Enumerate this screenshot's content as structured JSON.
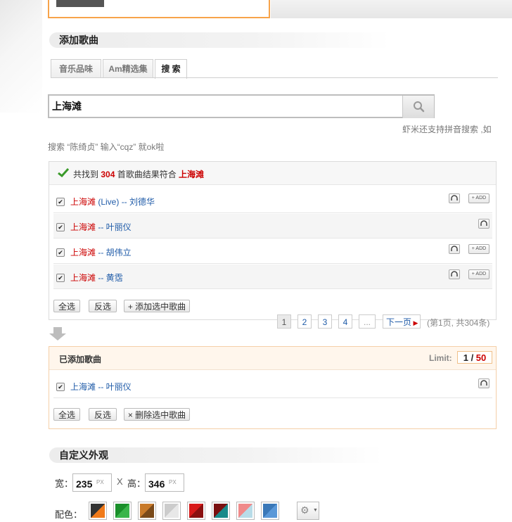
{
  "add_songs": {
    "title": "添加歌曲",
    "tabs": [
      {
        "label": "音乐品味"
      },
      {
        "label": "Am精选集"
      },
      {
        "label": "搜 索"
      }
    ],
    "search": {
      "value": "上海滩",
      "hint_line1": "虾米还支持拼音搜索 ,如",
      "hint_line2": "搜索 “陈绮贞” 输入“cqz” 就ok啦"
    },
    "results": {
      "prefix": "共找到 ",
      "count": "304",
      "middle": " 首歌曲结果符合 ",
      "keyword": "上海滩",
      "songs": [
        {
          "title": "上海滩",
          "rest": " (Live) -- 刘德华",
          "has_add": true
        },
        {
          "title": "上海滩",
          "rest": " -- 叶丽仪",
          "has_add": false
        },
        {
          "title": "上海滩",
          "rest": " -- 胡伟立",
          "has_add": true
        },
        {
          "title": "上海滩",
          "rest": " -- 黄霑",
          "has_add": true
        }
      ],
      "add_label": "+ ADD",
      "select_all": "全选",
      "invert": "反选",
      "add_selected": "+ 添加选中歌曲"
    },
    "pagination": {
      "pages": [
        "1",
        "2",
        "3",
        "4",
        "..."
      ],
      "next": "下一页",
      "info": "(第1页, 共304条)"
    }
  },
  "added_songs": {
    "title": "已添加歌曲",
    "limit_label": "Limit:",
    "limit_current": "1",
    "limit_sep": " / ",
    "limit_max": "50",
    "songs": [
      {
        "title": "上海滩",
        "rest": " -- 叶丽仪"
      }
    ],
    "select_all": "全选",
    "invert": "反选",
    "delete_selected": "× 删除选中歌曲"
  },
  "custom": {
    "title": "自定义外观",
    "width_label": "宽：",
    "width_value": "235",
    "height_label": "高：",
    "height_value": "346",
    "unit": "PX",
    "x": "X",
    "color_label": "配色：",
    "swatches": [
      {
        "a": "#333333",
        "b": "#f07a1a"
      },
      {
        "a": "#1a8f2a",
        "b": "#3ab54a"
      },
      {
        "a": "#c87a2a",
        "b": "#7a4a1a"
      },
      {
        "a": "#cccccc",
        "b": "#e8e8e8"
      },
      {
        "a": "#d81a1a",
        "b": "#8a1010"
      },
      {
        "a": "#7a1010",
        "b": "#1a8a8a"
      },
      {
        "a": "#f08a8a",
        "b": "#b8dce8"
      },
      {
        "a": "#3a78b8",
        "b": "#5a98d8"
      }
    ]
  }
}
